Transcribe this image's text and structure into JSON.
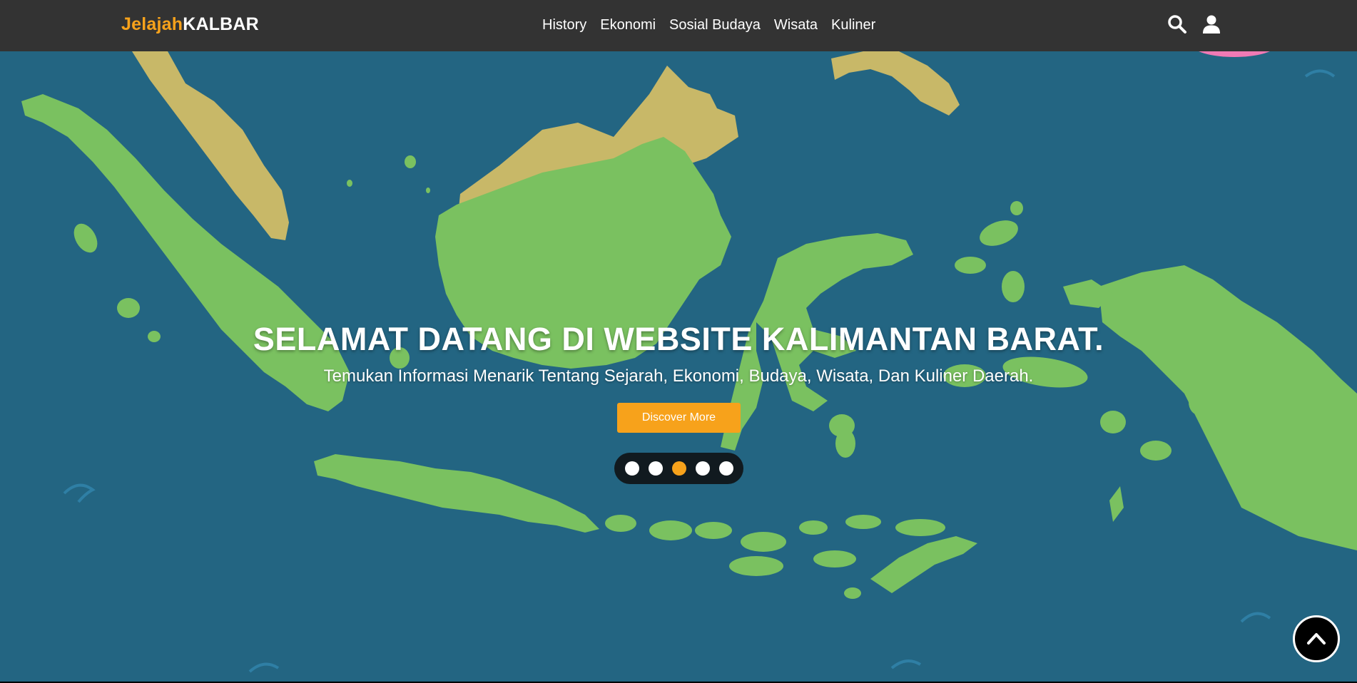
{
  "brand": {
    "part1": "Jelajah",
    "part2": "KALBAR"
  },
  "nav": {
    "items": [
      "History",
      "Ekonomi",
      "Sosial Budaya",
      "Wisata",
      "Kuliner"
    ],
    "icons": [
      "search-icon",
      "user-icon"
    ]
  },
  "hero": {
    "title": "SELAMAT DATANG DI WEBSITE KALIMANTAN BARAT.",
    "subtitle": "Temukan Informasi Menarik Tentang Sejarah, Ekonomi, Budaya, Wisata, Dan Kuliner Daerah.",
    "button": "Discover More",
    "slides": {
      "count": 5,
      "active": 3
    }
  },
  "colors": {
    "navbar": "#333333",
    "accent": "#f7a21b",
    "sea": "#236582",
    "land": "#7ac160",
    "land_neighbor": "#c8b868"
  },
  "scroll_top_icon": "chevron-up-icon"
}
